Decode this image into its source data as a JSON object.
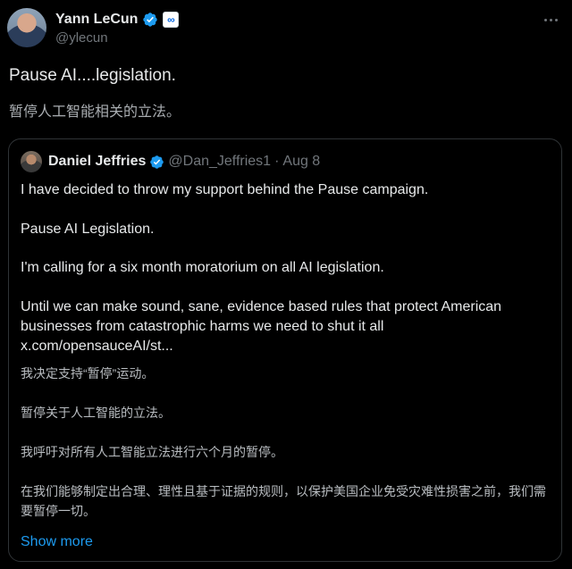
{
  "author": {
    "name": "Yann LeCun",
    "handle": "@ylecun",
    "affiliation_icon": "meta-logo-icon"
  },
  "tweet": {
    "text": "Pause AI....legislation.",
    "translation": "暂停人工智能相关的立法。"
  },
  "quote": {
    "name": "Daniel Jeffries",
    "handle": "@Dan_Jeffries1",
    "separator": "·",
    "date": "Aug 8",
    "paragraphs": [
      "I have decided to throw my support behind the Pause campaign.",
      "Pause AI Legislation.",
      "I'm calling for a six month moratorium on all AI legislation.",
      "Until we can make sound, sane, evidence based rules that protect American businesses from catastrophic harms we need to shut it all",
      "x.com/opensauceAI/st..."
    ],
    "translations": [
      "我决定支持“暂停”运动。",
      "暂停关于人工智能的立法。",
      "我呼吁对所有人工智能立法进行六个月的暂停。",
      "在我们能够制定出合理、理性且基于证据的规则，以保护美国企业免受灾难性损害之前，我们需要暂停一切。"
    ],
    "show_more": "Show more"
  },
  "colors": {
    "background": "#000000",
    "accent": "#1d9bf0",
    "muted": "#71767b",
    "border": "#2f3336"
  }
}
